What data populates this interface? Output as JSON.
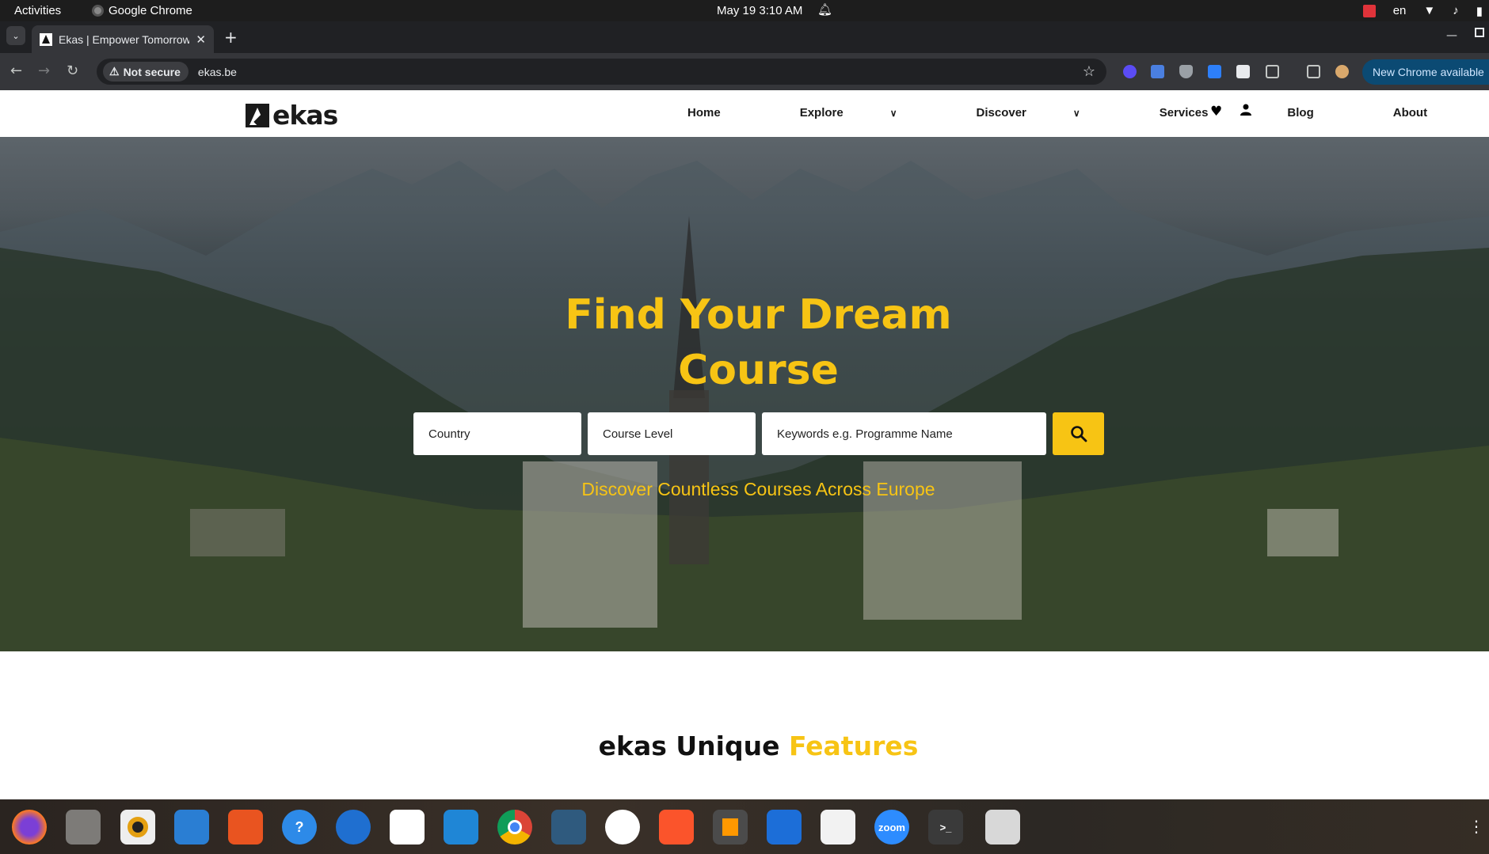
{
  "system": {
    "activities": "Activities",
    "app_name": "Google Chrome",
    "clock": "May 19  3:10 AM",
    "lang": "en"
  },
  "browser": {
    "tab_title": "Ekas | Empower Tomorrow",
    "new_tab": "+",
    "security_label": "Not secure",
    "url": "ekas.be",
    "new_chrome_label": "New Chrome available"
  },
  "site": {
    "logo_text": "ekas",
    "nav": {
      "home": "Home",
      "explore": "Explore",
      "discover": "Discover",
      "services": "Services",
      "blog": "Blog",
      "about": "About"
    },
    "hero": {
      "title_line1": "Find Your Dream",
      "title_line2": "Course",
      "country_placeholder": "Country",
      "level_placeholder": "Course Level",
      "keywords_placeholder": "Keywords e.g. Programme Name",
      "tagline": "Discover Countless Courses Across Europe"
    },
    "features": {
      "title_start": "ekas Unique ",
      "title_accent": "Features"
    }
  },
  "colors": {
    "accent": "#f7c414",
    "dark": "#1a1a1a"
  },
  "dock": {
    "apps": [
      "firefox-icon",
      "files-icon",
      "rhythmbox-icon",
      "writer-icon",
      "software-icon",
      "help-icon",
      "thunderbird-icon",
      "slack-icon",
      "vscode-icon",
      "chrome-icon",
      "mysql-workbench-icon",
      "app-icon",
      "brave-icon",
      "sublime-icon",
      "trello-icon",
      "document-viewer-icon",
      "zoom-icon",
      "terminal-icon",
      "trash-icon"
    ],
    "zoom_label": "zoom",
    "terminal_label": ">_"
  }
}
